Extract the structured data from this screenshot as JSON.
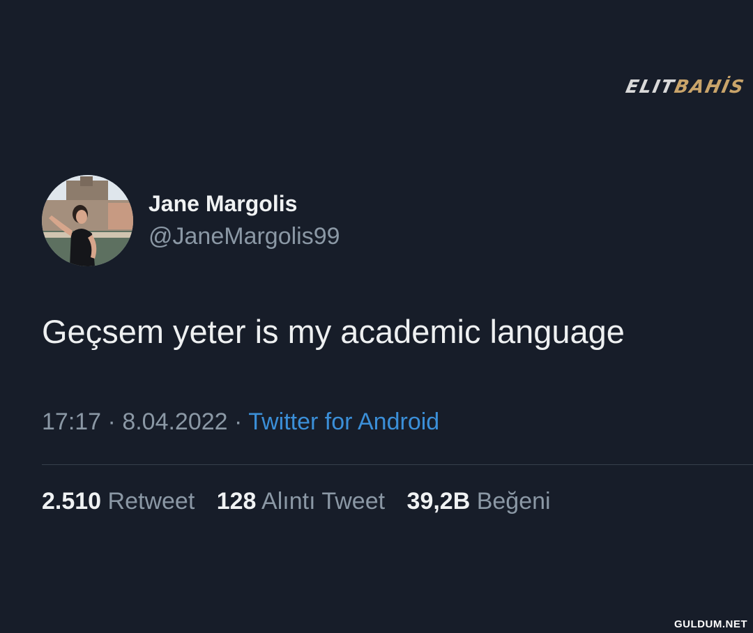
{
  "watermark_top": {
    "part_a": "ELIT",
    "part_b": "BAHİS"
  },
  "watermark_bottom": "GULDUM.NET",
  "tweet": {
    "display_name": "Jane Margolis",
    "handle": "@JaneMargolis99",
    "text": "Geçsem yeter is my academic language",
    "time": "17:17",
    "date": "8.04.2022",
    "separator": " · ",
    "source": "Twitter for Android",
    "stats": [
      {
        "count": "2.510",
        "label": "Retweet"
      },
      {
        "count": "128",
        "label": "Alıntı Tweet"
      },
      {
        "count": "39,2B",
        "label": "Beğeni"
      }
    ]
  },
  "colors": {
    "background": "#171d29",
    "link": "#3b8fd8",
    "secondary_text": "#8b98a5"
  }
}
